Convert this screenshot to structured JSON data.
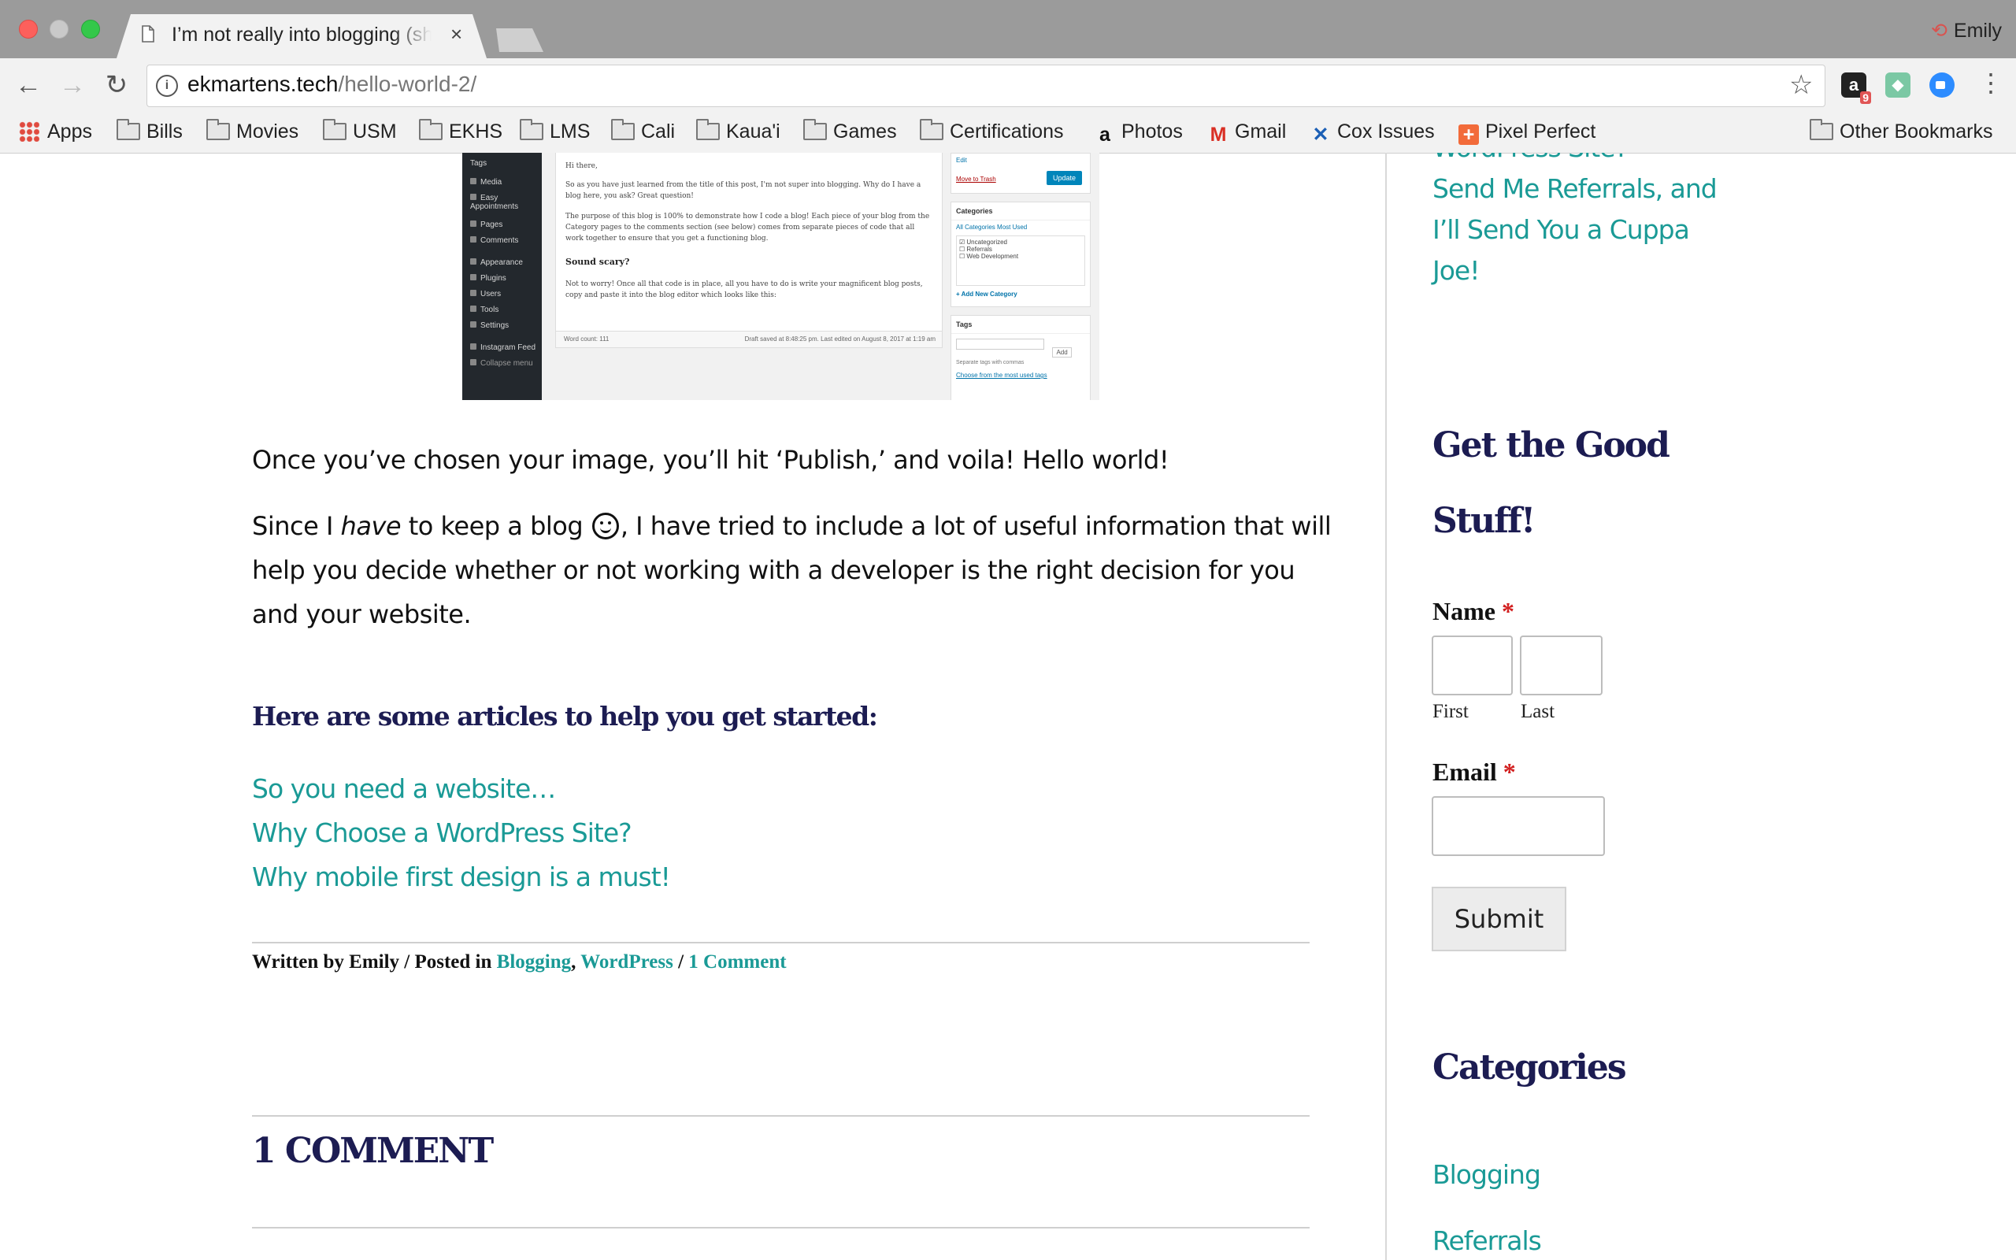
{
  "browser": {
    "tab_title": "I’m not really into blogging (sh",
    "tab_close": "×",
    "profile_name": "Emily",
    "url_host": "ekmartens.tech",
    "url_path": "/hello-world-2/",
    "extension_badge": "9",
    "bookmarks": [
      "Apps",
      "Bills",
      "Movies",
      "USM",
      "EKHS",
      "LMS",
      "Cali",
      "Kaua'i",
      "Games",
      "Certifications",
      "Photos",
      "Gmail",
      "Cox Issues",
      "Pixel Perfect"
    ],
    "other_bookmarks": "Other Bookmarks"
  },
  "screenshot": {
    "admin_menu": [
      "Tags",
      "Media",
      "Easy Appointments",
      "Pages",
      "Comments",
      "Appearance",
      "Plugins",
      "Users",
      "Tools",
      "Settings",
      "Instagram Feed",
      "Collapse menu"
    ],
    "editor_lines": [
      "Hi there,",
      "So as you have just learned from the title of this post, I'm not super into blogging. Why do I have a blog here, you ask? Great question!",
      "The purpose of this blog is 100% to demonstrate how I code a blog! Each piece of your blog from the Category pages to the comments section (see below) comes from separate pieces of code that all work together to ensure that you get a functioning blog.",
      "Sound scary?",
      "Not to worry! Once all that code is in place, all you have to do is write your magnificent blog posts, copy and paste it into the blog editor which looks like this:"
    ],
    "word_count": "Word count: 111",
    "draft_saved": "Draft saved at 8:48:25 pm. Last edited on August 8, 2017 at 1:19 am",
    "edit_link": "Edit",
    "move_to_trash": "Move to Trash",
    "update_button": "Update",
    "categories_title": "Categories",
    "categories_tabs": "All Categories   Most Used",
    "categories_items": [
      "Uncategorized",
      "Referrals",
      "Web Development"
    ],
    "add_category": "+ Add New Category",
    "tags_title": "Tags",
    "tags_add": "Add",
    "tags_help": "Separate tags with commas",
    "tags_choose": "Choose from the most used tags"
  },
  "post": {
    "paragraph1": "Once you’ve chosen your image, you’ll hit ‘Publish,’ and voila! Hello world!",
    "p2_before": "Since I ",
    "p2_em": "have",
    "p2_mid": " to keep a blog ",
    "p2_after": ", I have tried to include a lot of useful information that will help you decide whether or not working with a developer is the right decision for you and your website.",
    "articles_heading": "Here are some articles to help you get started:",
    "articles": [
      "So you need a website…",
      "Why Choose a WordPress Site?",
      "Why mobile first design is a must!"
    ],
    "meta_written": "Written by Emily / Posted in ",
    "meta_cat1": "Blogging",
    "meta_sep": ", ",
    "meta_cat2": "WordPress",
    "meta_slash": " / ",
    "meta_comments": "1 Comment",
    "comments_heading": "1 COMMENT"
  },
  "sidebar": {
    "top_link_cut": "WordPress Site?",
    "top_link_lines": [
      "Send Me Referrals, and",
      "I’ll Send You a Cuppa",
      "Joe!"
    ],
    "form_title_line1": "Get the Good",
    "form_title_line2": "Stuff!",
    "name_label": "Name",
    "required_mark": "*",
    "first_label": "First",
    "last_label": "Last",
    "email_label": "Email",
    "submit_label": "Submit",
    "categories_title": "Categories",
    "categories": [
      "Blogging",
      "Referrals"
    ]
  },
  "colors": {
    "link": "#1a9a96",
    "heading": "#1c1c52",
    "required": "#d21f1f"
  }
}
